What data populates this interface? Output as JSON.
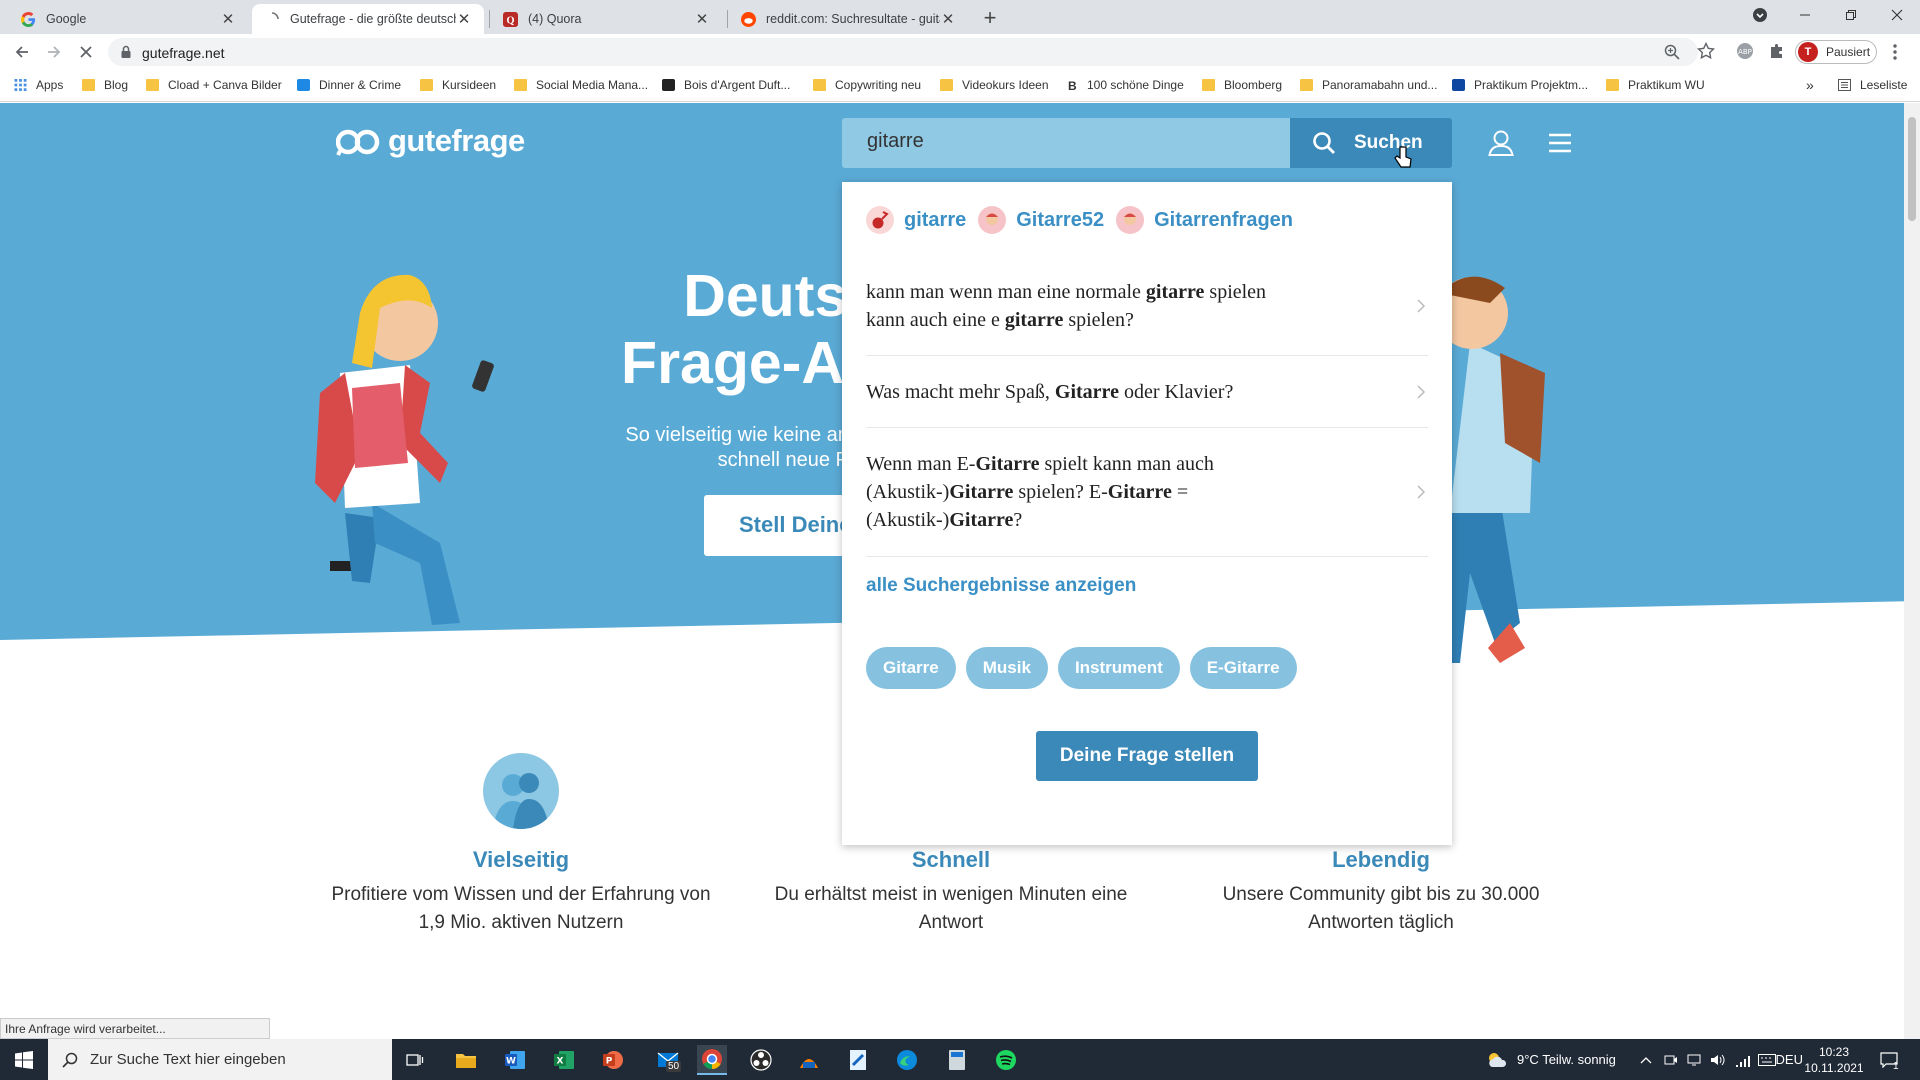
{
  "browser": {
    "tabs": [
      {
        "title": "Google",
        "active": false
      },
      {
        "title": "Gutefrage - die größte deutschsp",
        "active": true
      },
      {
        "title": "(4) Quora",
        "active": false
      },
      {
        "title": "reddit.com: Suchresultate - guita",
        "active": false
      }
    ],
    "url": "gutefrage.net",
    "profile_label": "Pausiert",
    "profile_initial": "T",
    "bookmarks": [
      "Apps",
      "Blog",
      "Cload + Canva Bilder",
      "Dinner & Crime",
      "Kursideen",
      "Social Media Mana...",
      "Bois d'Argent Duft...",
      "Copywriting neu",
      "Videokurs Ideen",
      "100 schöne Dinge",
      "Bloomberg",
      "Panoramabahn und...",
      "Praktikum Projektm...",
      "Praktikum WU"
    ],
    "reading_list": "Leseliste",
    "status_text": "Ihre Anfrage wird verarbeitet..."
  },
  "site": {
    "logo": "gutefrage",
    "search_value": "gitarre",
    "search_button": "Suchen",
    "hero_title_1": "Deutsc",
    "hero_title_2": "Frage-An",
    "hero_sub_1": "So vielseitig wie keine and",
    "hero_sub_2": "schnell neue Pe",
    "hero_cta": "Stell Deine",
    "colors": {
      "hero_blue": "#5aaad6",
      "accent": "#3a8fc5",
      "button": "#3b89b8"
    }
  },
  "dropdown": {
    "tag_suggestions": [
      "gitarre",
      "Gitarre52",
      "Gitarrenfragen"
    ],
    "all_results": "alle Suchergebnisse anzeigen",
    "chips": [
      "Gitarre",
      "Musik",
      "Instrument",
      "E-Gitarre"
    ],
    "ask_button": "Deine Frage stellen",
    "s1": {
      "a": "kann man wenn man eine normale ",
      "b": "gitarre",
      "c": " spielen",
      "d": "kann auch eine e ",
      "e": "gitarre",
      "f": " spielen?"
    },
    "s2": {
      "a": "Was macht mehr Spaß, ",
      "b": "Gitarre",
      "c": " oder Klavier?"
    },
    "s3": {
      "a": "Wenn man E-",
      "b": "Gitarre",
      "c": " spielt kann man auch",
      "d": "(Akustik-)",
      "e": "Gitarre",
      "f": " spielen? E-",
      "g": "Gitarre",
      "h": " =",
      "i": "(Akustik-)",
      "j": "Gitarre",
      "k": "?"
    }
  },
  "features": [
    {
      "title": "Vielseitig",
      "text_1": "Profitiere vom Wissen und der Erfahrung von",
      "text_2": "1,9 Mio. aktiven Nutzern"
    },
    {
      "title": "Schnell",
      "text_1": "Du erhältst meist in wenigen Minuten eine",
      "text_2": "Antwort"
    },
    {
      "title": "Lebendig",
      "text_1": "Unsere Community gibt bis zu 30.000",
      "text_2": "Antworten täglich"
    }
  ],
  "taskbar": {
    "search_placeholder": "Zur Suche Text hier eingeben",
    "mail_badge": "50",
    "weather": "9°C  Teilw. sonnig",
    "language": "DEU",
    "time": "10:23",
    "date": "10.11.2021",
    "notifications": "1"
  }
}
